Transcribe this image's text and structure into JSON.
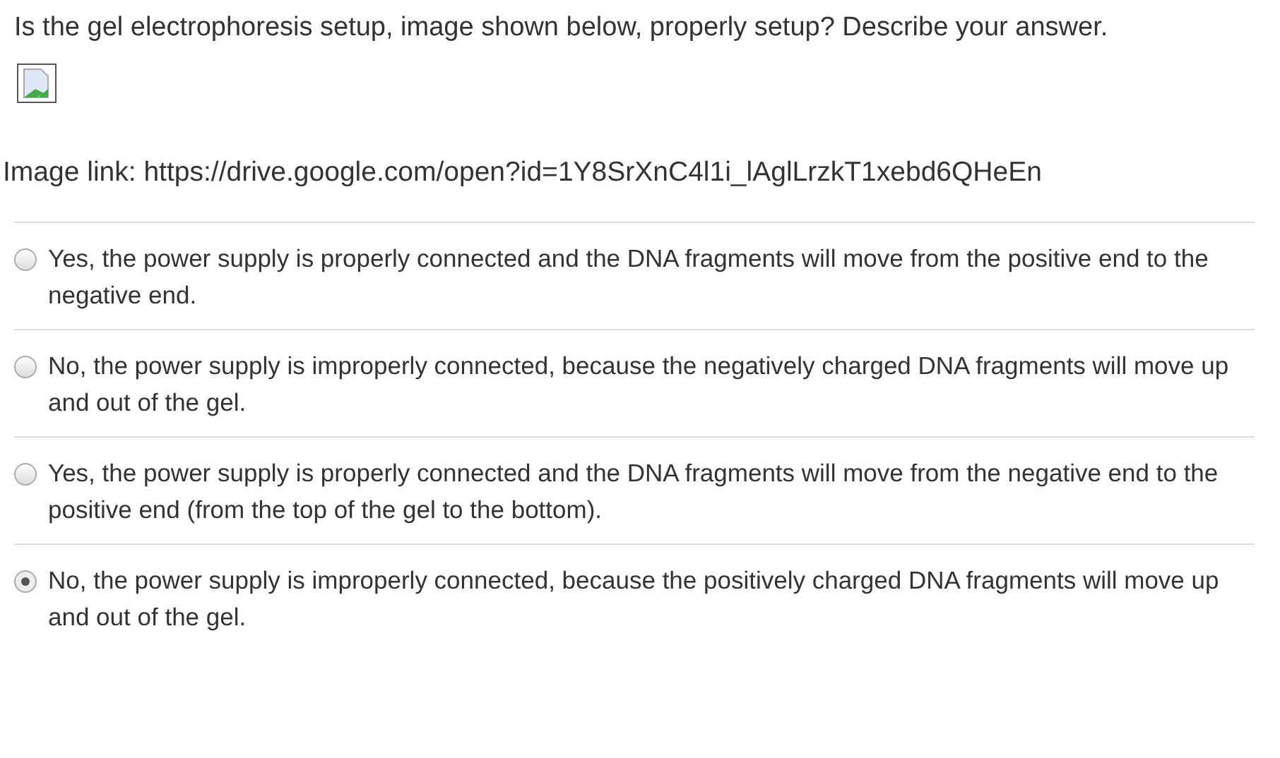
{
  "question": "Is the gel electrophoresis setup, image shown below, properly setup? Describe your answer.",
  "image": {
    "kind": "broken-image"
  },
  "image_link": "Image link: https://drive.google.com/open?id=1Y8SrXnC4l1i_lAglLrzkT1xebd6QHeEn",
  "options": [
    {
      "label": "Yes, the power supply is properly connected and the DNA fragments will move from the positive end to the negative end.",
      "selected": false
    },
    {
      "label": "No, the power supply is improperly connected, because the negatively charged DNA fragments will move up and out of the gel.",
      "selected": false
    },
    {
      "label": "Yes, the power supply is properly connected and the DNA fragments will move from the negative end to the positive end (from the top of the gel to the bottom).",
      "selected": false
    },
    {
      "label": "No, the power supply is improperly connected, because the positively charged DNA fragments will move up and out of the gel.",
      "selected": true
    }
  ]
}
